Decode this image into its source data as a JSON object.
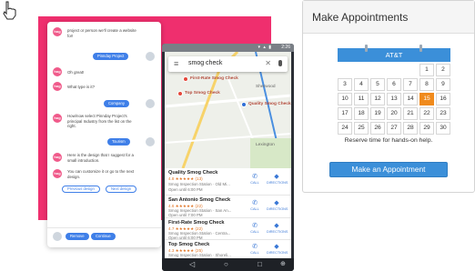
{
  "chat": {
    "brand_partial": "hoglo",
    "messages": [
      {
        "text": "project or person we'll create a website for!"
      },
      {
        "text": "Oh great!"
      },
      {
        "text": "What type is it?"
      },
      {
        "text": "How/now select Pinnday Project's principal Industry from the list on the right."
      },
      {
        "text": "Here is the design that I suggest for a small introduction."
      },
      {
        "text": "You can customize it or go to the next design."
      }
    ],
    "replies": [
      "Pinnday Project",
      "Company",
      "Tourism"
    ],
    "suggest_buttons": [
      "Previous design",
      "Next design"
    ],
    "footer_buttons": [
      "Remove",
      "Continue"
    ]
  },
  "phone": {
    "status_time": "2:26",
    "search_query": "smog check",
    "map_labels": [
      "First-Rate Smog Check",
      "Top Smog Check",
      "Quality Smog Check",
      "Sherwood",
      "Lexington"
    ],
    "results": [
      {
        "name": "Quality Smog Check",
        "rating": "4.8 ★★★★★ (13)",
        "line1": "Smog Inspection Station · Old Mi...",
        "line2": "Open until 6:00 PM",
        "ad": "Ad"
      },
      {
        "name": "San Antonio Smog Check",
        "rating": "4.6 ★★★★★ (22)",
        "line1": "Smog Inspection Station · San An...",
        "line2": "Open until 7:00 PM"
      },
      {
        "name": "First-Rate Smog Check",
        "rating": "4.7 ★★★★★ (22)",
        "line1": "Smog Inspection Station · Centra...",
        "line2": "Open until 6:00 PM"
      },
      {
        "name": "Top Smog Check",
        "rating": "4.3 ★★★★★ (25)",
        "line1": "Smog Inspection Station · Shoreli...",
        "line2": "Open until 6:30 PM"
      }
    ],
    "call_label": "CALL",
    "directions_label": "DIRECTIONS"
  },
  "appointment": {
    "title": "Make Appointments",
    "calendar_header": "AT&T",
    "rows": [
      [
        "",
        "",
        "",
        "",
        "",
        "1",
        "2"
      ],
      [
        "3",
        "4",
        "5",
        "6",
        "7",
        "8",
        "9"
      ],
      [
        "10",
        "11",
        "12",
        "13",
        "14",
        "15",
        "16"
      ],
      [
        "17",
        "18",
        "19",
        "20",
        "21",
        "22",
        "23"
      ],
      [
        "24",
        "25",
        "26",
        "27",
        "28",
        "29",
        "30"
      ]
    ],
    "highlighted_day": "15",
    "note": "Reserve time for hands-on help.",
    "button_label": "Make an Appointment",
    "accent_color": "#3b8fd9",
    "highlight_color": "#f08a1c"
  }
}
